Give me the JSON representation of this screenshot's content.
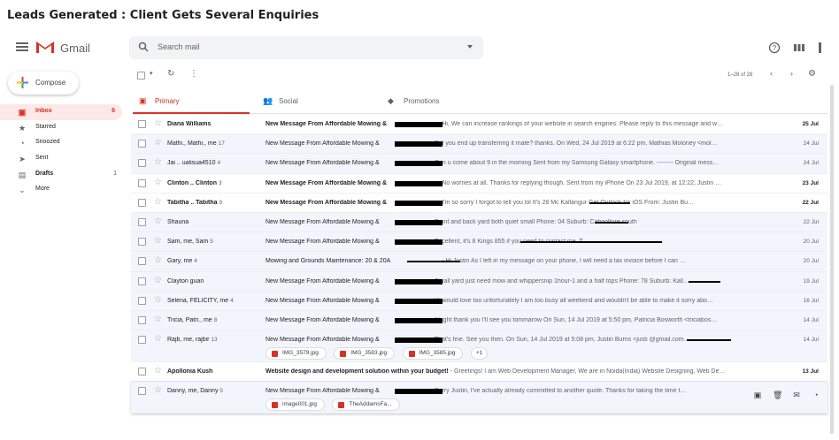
{
  "caption": "Leads Generated : Client Gets Several Enquiries",
  "app": {
    "name": "Gmail"
  },
  "search": {
    "placeholder": "Search mail"
  },
  "sidebar": {
    "compose_label": "Compose",
    "items": [
      {
        "label": "Inbox",
        "count": "6",
        "icon": "inbox-icon",
        "active": true
      },
      {
        "label": "Starred",
        "count": "",
        "icon": "star-icon"
      },
      {
        "label": "Snoozed",
        "count": "",
        "icon": "clock-icon"
      },
      {
        "label": "Sent",
        "count": "",
        "icon": "send-icon"
      },
      {
        "label": "Drafts",
        "count": "1",
        "icon": "draft-icon",
        "bold": true
      },
      {
        "label": "More",
        "count": "",
        "icon": "chevron-down-icon"
      }
    ]
  },
  "toolbar": {
    "range": "1–28 of 28"
  },
  "tabs": [
    {
      "label": "Primary",
      "icon": "inbox-icon",
      "active": true
    },
    {
      "label": "Social",
      "icon": "people-icon"
    },
    {
      "label": "Promotions",
      "icon": "tag-icon"
    }
  ],
  "emails": [
    {
      "sender": "Diana Williams",
      "count": "",
      "subject": "New Message From Affordable Mowing &",
      "snippet": "- Hi, We can increase rankings of your website in search engines. Please reply to this message and w…",
      "date": "25 Jul",
      "unread": true
    },
    {
      "sender": "Mathi., Mathi., me",
      "count": "17",
      "subject": "New Message From Affordable Mowing &",
      "snippet": "- Did you end up transferring it mate? thanks. On Wed, 24 Jul 2019 at 6:22 pm, Mathias Moloney <mol…",
      "date": "24 Jul",
      "unread": false
    },
    {
      "sender": "Jai .. ualisua4510",
      "count": "4",
      "subject": "New Message From Affordable Mowing &",
      "snippet": "- Can u come about 9 in the morning Sent from my Samsung Galaxy smartphone. -------- Original mess…",
      "date": "24 Jul",
      "unread": false
    },
    {
      "sender": "Clinton .. Clinton",
      "count": "3",
      "subject": "New Message From Affordable Mowing &",
      "snippet": "- No worries at all. Thanks for replying though. Sent from my iPhone On 23 Jul 2019, at 12:22, Justin …",
      "date": "23 Jul",
      "unread": true
    },
    {
      "sender": "Tabitha .. Tabitha",
      "count": "9",
      "subject": "New Message From Affordable Mowing &",
      "snippet": "- I'm so sorry I forgot to tell you lol It's 28 Mc Kallangur Get Outlook for iOS From: Justin Bu…",
      "date": "22 Jul",
      "unread": true
    },
    {
      "sender": "Shauna",
      "count": "",
      "subject": "New Message From Affordable Mowing &",
      "snippet": "- Front and back yard both quiet small Phone: 04 Suburb: Caboolture south",
      "date": "22 Jul",
      "unread": false
    },
    {
      "sender": "Sam, me, Sam",
      "count": "5",
      "subject": "New Message From Affordable Mowing &",
      "snippet": "- Excellent, it's 8 Kings 855 if you need to contact me. T…",
      "date": "20 Jul",
      "unread": false
    },
    {
      "sender": "Gary, me",
      "count": "4",
      "subject": "Mowing and Grounds Maintenance: 20 & 20A",
      "snippet": "- Hi Justin As I left in my message on your phone, I will need a tax invoice before I can …",
      "date": "20 Jul",
      "unread": false
    },
    {
      "sender": "Clayton guan",
      "count": "",
      "subject": "New Message From Affordable Mowing &",
      "snippet": "- Small yard just need mow and whippersnip 1hour-1 and a half tops Phone: 78 Suburb: Kall…",
      "date": "19 Jul",
      "unread": false
    },
    {
      "sender": "Selena, FELICITY, me",
      "count": "4",
      "subject": "New Message From Affordable Mowing &",
      "snippet": "- Hi would love too unfortunately I am too busy all weekend and wouldn't be able to make it sorry abo…",
      "date": "16 Jul",
      "unread": false
    },
    {
      "sender": "Tricia, Patri., me",
      "count": "8",
      "subject": "New Message From Affordable Mowing &",
      "snippet": "- Alright thank you I'll see you tommarow On Sun, 14 Jul 2019 at 5:50 pm, Patricia Bosworth <triciabos…",
      "date": "14 Jul",
      "unread": false
    },
    {
      "sender": "Rajb, me, rajbir",
      "count": "13",
      "subject": "New Message From Affordable Mowing &",
      "snippet": "- That's fine. See you then. On Sun, 14 Jul 2019 at 5:08 pm, Justin Burns <justi @gmail.com…",
      "date": "14 Jul",
      "unread": false,
      "attachments": [
        "IMG_3579.jpg",
        "IMG_3583.jpg",
        "IMG_3585.jpg"
      ],
      "more": "+1"
    },
    {
      "sender": "Apollonia Kush",
      "count": "",
      "subject": "Website design and development solution within your budget!",
      "snippet": "- Greetings! I am Web Development Manager, We are in Noida(India) Website Designing, Web De…",
      "date": "13 Jul",
      "unread": true
    },
    {
      "sender": "Danny, me, Danny",
      "count": "5",
      "subject": "New Message From Affordable Mowing &",
      "snippet": "- Sorry Justin, I've actually already committed to another quote. Thanks for taking the time t…",
      "date": "",
      "unread": false,
      "attachments": [
        "image001.jpg",
        "TheAddamsFa..."
      ],
      "hover": true
    }
  ]
}
